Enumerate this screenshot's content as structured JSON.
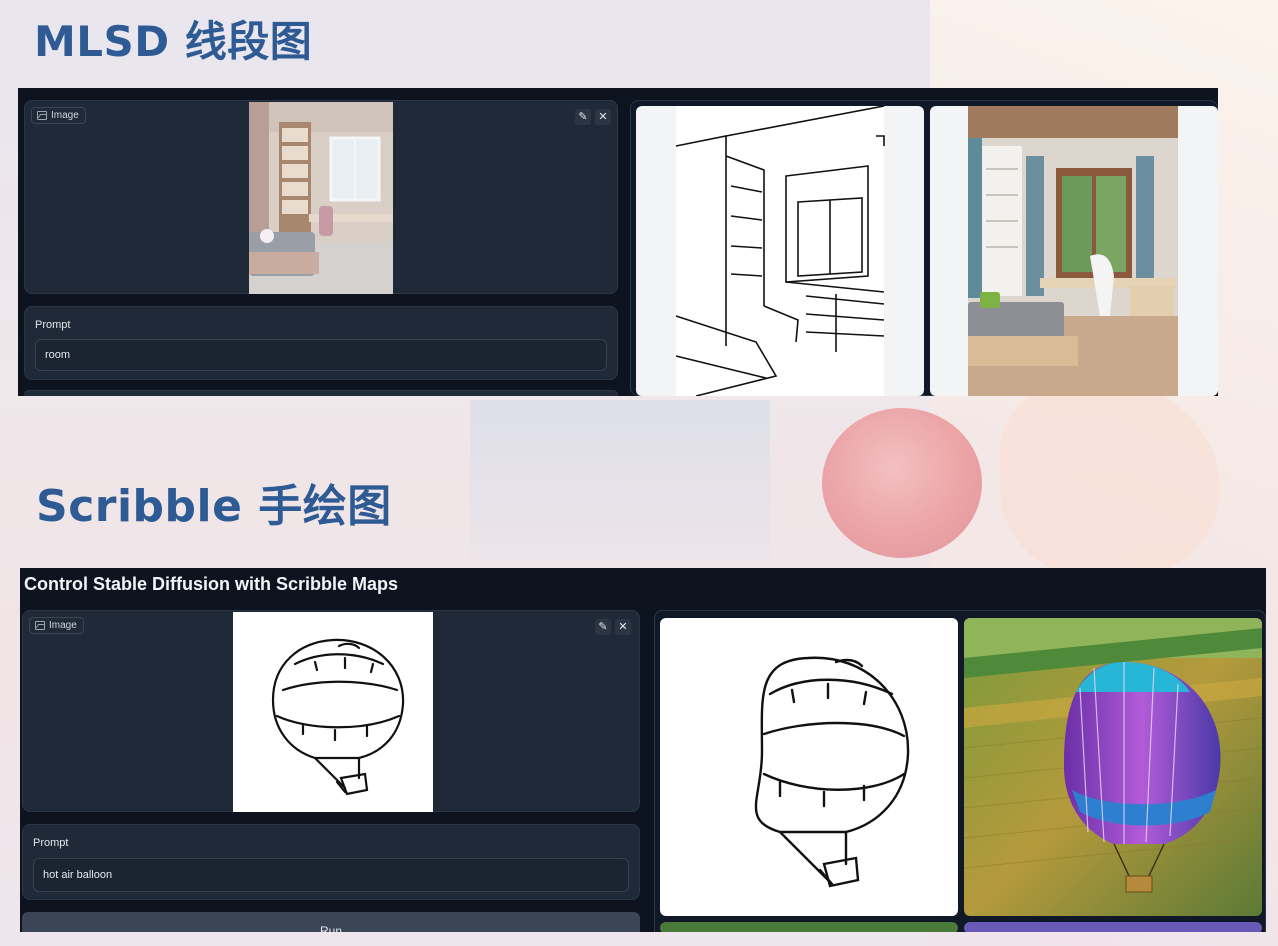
{
  "section1": {
    "title": "MLSD 线段图",
    "image_label": "Image",
    "prompt_label": "Prompt",
    "prompt_value": "room"
  },
  "section2": {
    "title": "Scribble 手绘图",
    "app_header": "Control Stable Diffusion with Scribble Maps",
    "image_label": "Image",
    "prompt_label": "Prompt",
    "prompt_value": "hot air balloon",
    "run_label": "Run"
  },
  "icons": {
    "image": "image-icon",
    "edit": "pencil-icon",
    "clear": "close-icon"
  },
  "colors": {
    "title": "#2f5b95",
    "app_bg": "#0d1420",
    "panel_bg": "#1f2937"
  }
}
